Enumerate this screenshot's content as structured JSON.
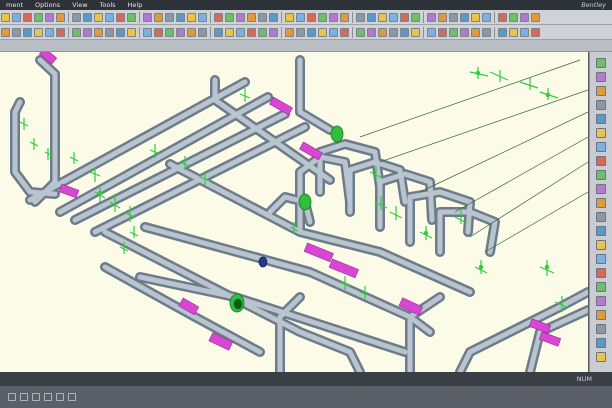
{
  "app": {
    "brand_text": "Bentley"
  },
  "menu": [
    "ment",
    "Options",
    "View",
    "Tools",
    "Help"
  ],
  "status": {
    "num_label": "NUM"
  },
  "colors": {
    "pipe": "#9aa8b6",
    "pipe_dark": "#6d7c8b",
    "fitting": "#d946d4",
    "support": "#2ecc40",
    "viewport_bg": "#fbfbe8"
  },
  "toolbar_icons": [
    "select-icon",
    "copy-icon",
    "paste-icon",
    "undo-icon",
    "redo-icon",
    "zoom-icon",
    "pan-icon",
    "rotate-icon",
    "fit-view-icon",
    "layer-icon",
    "pipe-icon",
    "elbow-icon",
    "tee-icon",
    "valve-icon",
    "flange-icon",
    "support-icon",
    "measure-icon",
    "section-icon",
    "render-icon",
    "print-icon",
    "save-icon",
    "open-icon",
    "settings-icon",
    "help-icon"
  ]
}
